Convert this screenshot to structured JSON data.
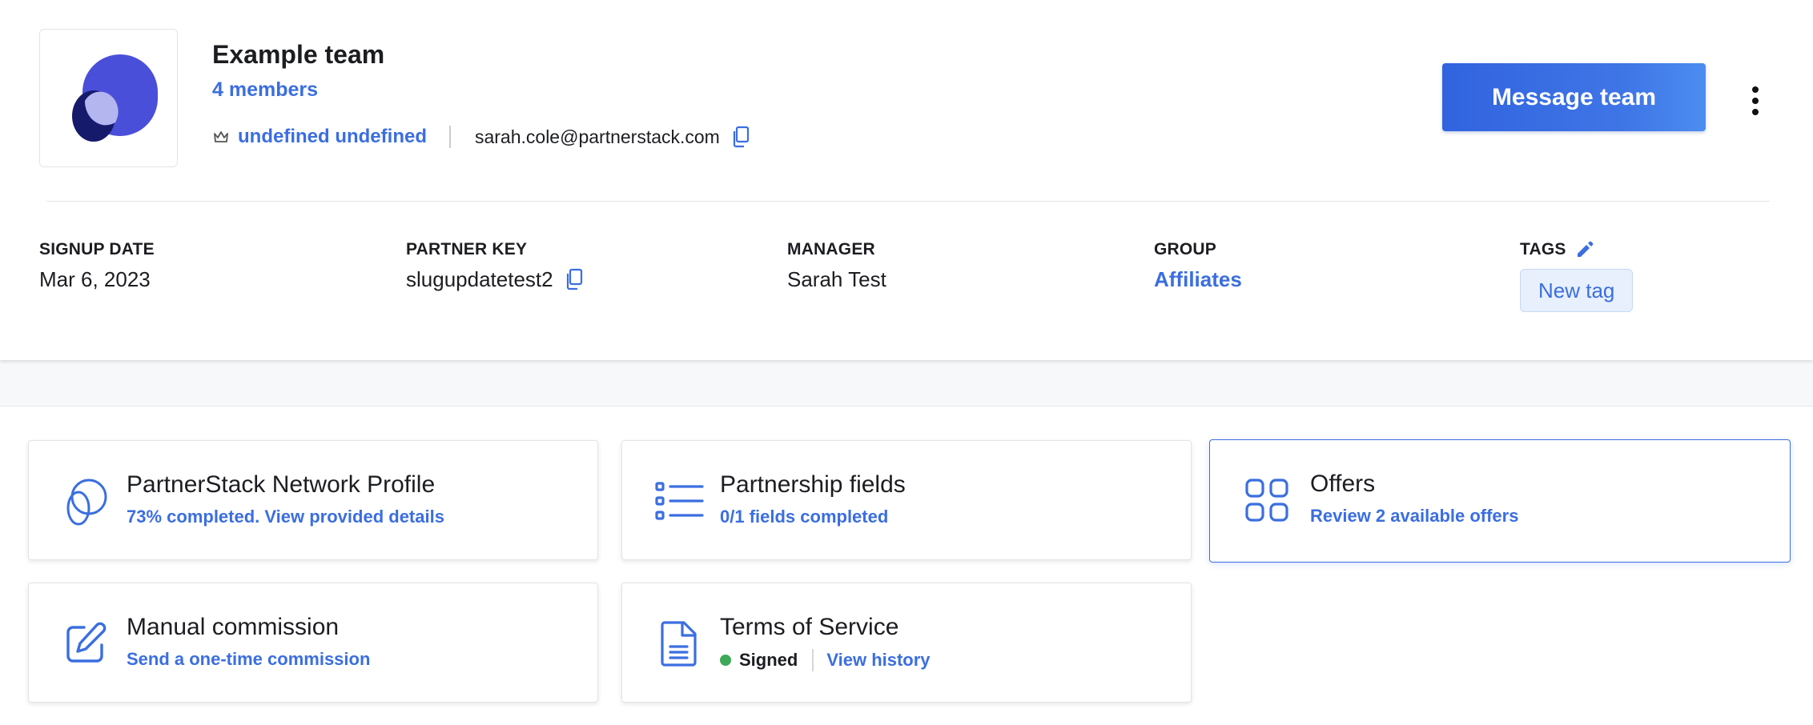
{
  "header": {
    "team_name": "Example team",
    "members_link": "4 members",
    "owner_name": "undefined undefined",
    "owner_email": "sarah.cole@partnerstack.com",
    "message_button": "Message team"
  },
  "meta": {
    "signup_date": {
      "label": "SIGNUP DATE",
      "value": "Mar 6, 2023"
    },
    "partner_key": {
      "label": "PARTNER KEY",
      "value": "slugupdatetest2"
    },
    "manager": {
      "label": "MANAGER",
      "value": "Sarah Test"
    },
    "group": {
      "label": "GROUP",
      "value": "Affiliates"
    },
    "tags": {
      "label": "TAGS",
      "new_tag": "New tag"
    }
  },
  "cards": {
    "network_profile": {
      "title": "PartnerStack Network Profile",
      "subtitle": "73% completed. View provided details",
      "icon": "circles-icon"
    },
    "partnership_fields": {
      "title": "Partnership fields",
      "subtitle": "0/1 fields completed",
      "icon": "list-icon"
    },
    "offers": {
      "title": "Offers",
      "subtitle": "Review 2 available offers",
      "icon": "grid-icon"
    },
    "manual_commission": {
      "title": "Manual commission",
      "subtitle": "Send a one-time commission",
      "icon": "edit-icon"
    },
    "terms_of_service": {
      "title": "Terms of Service",
      "status": "Signed",
      "history_link": "View history",
      "icon": "document-icon",
      "status_color": "#3daa57"
    }
  },
  "colors": {
    "accent": "#3b6ee0",
    "logo_primary": "#4a4fd9",
    "logo_dark": "#151a6b",
    "logo_light": "#b3b6ef"
  }
}
